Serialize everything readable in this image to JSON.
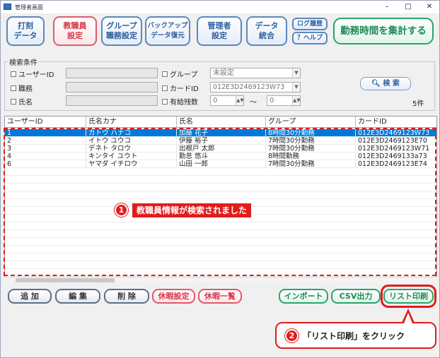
{
  "window": {
    "title": "管理者画面",
    "minimize": "–",
    "maximize": "□",
    "close": "✕"
  },
  "toolbar": {
    "punch": [
      "打刻",
      "データ"
    ],
    "staff": [
      "教職員",
      "設定"
    ],
    "group": [
      "グループ",
      "職務設定"
    ],
    "backup": [
      "バックアップ",
      "データ復元"
    ],
    "admin": [
      "管理者",
      "設定"
    ],
    "merge": [
      "データ",
      "統合"
    ],
    "log": "ログ履歴",
    "help": "？ヘルプ",
    "summary": "勤務時間を集計する"
  },
  "search": {
    "legend": "検索条件",
    "user_id": "ユーザーID",
    "duty": "職務",
    "name": "氏名",
    "group": "グループ",
    "group_value": "未設定",
    "card_id": "カードID",
    "card_value": "012E3D2469123W73",
    "paid_leave": "有給残数",
    "leave_from": "0",
    "leave_to": "0",
    "tilde": "〜",
    "button": "検 索",
    "count": "5件"
  },
  "grid": {
    "columns": [
      "ユーザーID",
      "氏名カナ",
      "氏名",
      "グループ",
      "カードID"
    ],
    "rows": [
      [
        "1",
        "カトウ ハナコ",
        "加藤 花子",
        "8時間30分勤務",
        "012E3D2469123W73"
      ],
      [
        "2",
        "イトウ ユウコ",
        "伊藤 裕子",
        "7時間30分勤務",
        "012E3D2469123E70"
      ],
      [
        "3",
        "デネト タロウ",
        "出根戸 太郎",
        "7時間30分勤務",
        "012E3D2469123W71"
      ],
      [
        "4",
        "キンタイ ユウト",
        "勤怠 悠斗",
        "8時間勤務",
        "012E3D2469133a73"
      ],
      [
        "6",
        "ヤマダ イチロウ",
        "山田 一郎",
        "7時間30分勤務",
        "012E3D2469123E74"
      ]
    ]
  },
  "banner": {
    "num": "1",
    "text": "教職員情報が検索されました"
  },
  "bottom": {
    "add": "追 加",
    "edit": "編 集",
    "delete": "削 除",
    "leave_setting": "休暇設定",
    "leave_list": "休暇一覧",
    "import": "インポート",
    "csv": "CSV出力",
    "print": "リスト印刷"
  },
  "callout": {
    "num": "2",
    "text": "「リスト印刷」をクリック"
  },
  "colors": {
    "accent_red": "#e11c1c",
    "selected_row": "#0078d7",
    "blue": "#2e5f9e",
    "green": "#1e8a55"
  }
}
